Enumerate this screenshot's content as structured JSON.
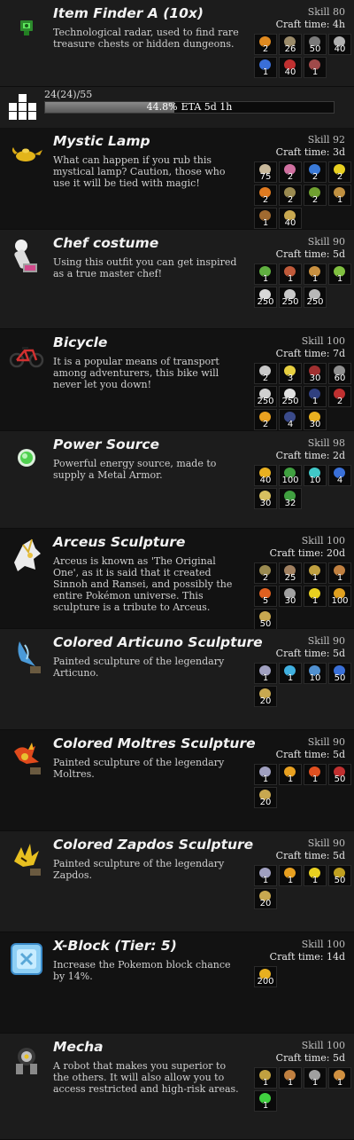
{
  "progress": {
    "count": "24(24)/55",
    "percent": "44.8%",
    "eta": "ETA 5d 1h",
    "fraction": 0.448
  },
  "items": [
    {
      "name": "Item Finder A (10x)",
      "description": "Technological radar, used to find rare treasure chests or hidden dungeons.",
      "skill": "Skill 80",
      "craft_time": "Craft time: 4h",
      "icon": "radar-icon",
      "icon_color": "#3ad13a",
      "materials": [
        {
          "icon": "orange-crystal-icon",
          "qty": "2",
          "color": "#e08a20"
        },
        {
          "icon": "gear-icon",
          "qty": "26",
          "color": "#9b8b6a"
        },
        {
          "icon": "chip-icon",
          "qty": "50",
          "color": "#7a7a7a"
        },
        {
          "icon": "wire-icon",
          "qty": "40",
          "color": "#b0b0b0"
        },
        {
          "icon": "blue-stone-icon",
          "qty": "1",
          "color": "#3a6fd8"
        },
        {
          "icon": "red-gem-icon",
          "qty": "40",
          "color": "#c03030"
        },
        {
          "icon": "wing-icon",
          "qty": "1",
          "color": "#a04a4a"
        }
      ]
    },
    {
      "name": "Mystic Lamp",
      "description": "What can happen if you rub this mystical lamp? Caution, those who use it will be tied with magic!",
      "skill": "Skill 92",
      "craft_time": "Craft time: 3d",
      "icon": "lamp-icon",
      "icon_color": "#e8c020",
      "materials": [
        {
          "icon": "scroll-icon",
          "qty": "75",
          "color": "#c8b89a"
        },
        {
          "icon": "feather-icon",
          "qty": "2",
          "color": "#d070a0"
        },
        {
          "icon": "swirl-icon",
          "qty": "2",
          "color": "#3a7ad8"
        },
        {
          "icon": "star-icon",
          "qty": "2",
          "color": "#e8d020"
        },
        {
          "icon": "flame-icon",
          "qty": "2",
          "color": "#e07a20"
        },
        {
          "icon": "rock-icon",
          "qty": "2",
          "color": "#9a8a50"
        },
        {
          "icon": "bug-icon",
          "qty": "2",
          "color": "#70a030"
        },
        {
          "icon": "figure-icon",
          "qty": "1",
          "color": "#c09040"
        },
        {
          "icon": "chest-icon",
          "qty": "1",
          "color": "#a06a30"
        },
        {
          "icon": "dust-icon",
          "qty": "40",
          "color": "#c8a850"
        }
      ]
    },
    {
      "name": "Chef costume",
      "description": "Using this outfit you can get inspired as a true master chef!",
      "skill": "Skill 90",
      "craft_time": "Craft time: 5d",
      "icon": "chef-icon",
      "icon_color": "#e8e8e8",
      "materials": [
        {
          "icon": "herb-icon",
          "qty": "1",
          "color": "#60b040"
        },
        {
          "icon": "meat-icon",
          "qty": "1",
          "color": "#c05a3a"
        },
        {
          "icon": "pie-icon",
          "qty": "1",
          "color": "#c89040"
        },
        {
          "icon": "leaf-icon",
          "qty": "1",
          "color": "#80c040"
        },
        {
          "icon": "cloth-icon",
          "qty": "250",
          "color": "#d8d8d8"
        },
        {
          "icon": "cloth-icon",
          "qty": "250",
          "color": "#c8c8c8"
        },
        {
          "icon": "cloth-icon",
          "qty": "250",
          "color": "#b8b8b8"
        }
      ]
    },
    {
      "name": "Bicycle",
      "description": "It is a popular means of transport among adventurers, this bike will never let you down!",
      "skill": "Skill 100",
      "craft_time": "Craft time: 7d",
      "icon": "bicycle-icon",
      "icon_color": "#d03030",
      "materials": [
        {
          "icon": "metal-icon",
          "qty": "2",
          "color": "#c8c8c8"
        },
        {
          "icon": "bolt-icon",
          "qty": "3",
          "color": "#e8d040"
        },
        {
          "icon": "rubber-icon",
          "qty": "30",
          "color": "#a03030"
        },
        {
          "icon": "claw-icon",
          "qty": "60",
          "color": "#909090"
        },
        {
          "icon": "plate-icon",
          "qty": "250",
          "color": "#d0d0d0"
        },
        {
          "icon": "plate-icon",
          "qty": "250",
          "color": "#e0e0e0"
        },
        {
          "icon": "nail-icon",
          "qty": "1",
          "color": "#304080"
        },
        {
          "icon": "spike-icon",
          "qty": "2",
          "color": "#c03030"
        },
        {
          "icon": "spark-icon",
          "qty": "2",
          "color": "#e8a020"
        },
        {
          "icon": "shard-icon",
          "qty": "4",
          "color": "#3a4a8a"
        },
        {
          "icon": "gold-icon",
          "qty": "30",
          "color": "#e8b020"
        }
      ]
    },
    {
      "name": "Power Source",
      "description": "Powerful energy source, made to supply a Metal Armor.",
      "skill": "Skill 98",
      "craft_time": "Craft time: 2d",
      "icon": "energy-orb-icon",
      "icon_color": "#40d040",
      "materials": [
        {
          "icon": "gold-icon",
          "qty": "40",
          "color": "#e8b020"
        },
        {
          "icon": "leaf-icon",
          "qty": "100",
          "color": "#40a040"
        },
        {
          "icon": "crystal-icon",
          "qty": "10",
          "color": "#40c8c8"
        },
        {
          "icon": "blue-gem-icon",
          "qty": "4",
          "color": "#3a70d8"
        },
        {
          "icon": "sand-icon",
          "qty": "30",
          "color": "#d8c060"
        },
        {
          "icon": "vine-icon",
          "qty": "32",
          "color": "#40a040"
        }
      ]
    },
    {
      "name": "Arceus Sculpture",
      "description": "Arceus is known as 'The Original One', as it is said that it created Sinnoh and Ransei, and possibly the entire Pokémon universe. This sculpture is a tribute to Arceus.",
      "skill": "Skill 100",
      "craft_time": "Craft time: 20d",
      "icon": "arceus-icon",
      "icon_color": "#e8e8e8",
      "materials": [
        {
          "icon": "rock-icon",
          "qty": "2",
          "color": "#9a8a50"
        },
        {
          "icon": "clay-icon",
          "qty": "25",
          "color": "#a08060"
        },
        {
          "icon": "idol-icon",
          "qty": "1",
          "color": "#c0a040"
        },
        {
          "icon": "figure-icon",
          "qty": "1",
          "color": "#c08040"
        },
        {
          "icon": "fire-icon",
          "qty": "5",
          "color": "#e06020"
        },
        {
          "icon": "claw-icon",
          "qty": "30",
          "color": "#a0a0a0"
        },
        {
          "icon": "star-icon",
          "qty": "1",
          "color": "#e8d020"
        },
        {
          "icon": "paint-icon",
          "qty": "100",
          "color": "#e0a020"
        },
        {
          "icon": "dust-icon",
          "qty": "50",
          "color": "#c8a850"
        }
      ]
    },
    {
      "name": "Colored Articuno Sculpture",
      "description": "Painted sculpture of the legendary Articuno.",
      "skill": "Skill 90",
      "craft_time": "Craft time: 5d",
      "icon": "articuno-icon",
      "icon_color": "#60a8e8",
      "materials": [
        {
          "icon": "wing-icon",
          "qty": "1",
          "color": "#a0a0c0"
        },
        {
          "icon": "ice-icon",
          "qty": "1",
          "color": "#40b0e0"
        },
        {
          "icon": "frost-icon",
          "qty": "10",
          "color": "#5090d0"
        },
        {
          "icon": "paint-icon",
          "qty": "50",
          "color": "#3a70d8"
        },
        {
          "icon": "dust-icon",
          "qty": "20",
          "color": "#c8a850"
        }
      ]
    },
    {
      "name": "Colored Moltres Sculpture",
      "description": "Painted sculpture of the legendary Moltres.",
      "skill": "Skill 90",
      "craft_time": "Craft time: 5d",
      "icon": "moltres-icon",
      "icon_color": "#e05020",
      "materials": [
        {
          "icon": "wing-icon",
          "qty": "1",
          "color": "#a0a0c0"
        },
        {
          "icon": "ember-icon",
          "qty": "1",
          "color": "#e8a020"
        },
        {
          "icon": "fire-icon",
          "qty": "1",
          "color": "#e05020"
        },
        {
          "icon": "paint-icon",
          "qty": "50",
          "color": "#c03030"
        },
        {
          "icon": "dust-icon",
          "qty": "20",
          "color": "#c8a850"
        }
      ]
    },
    {
      "name": "Colored Zapdos Sculpture",
      "description": "Painted sculpture of the legendary Zapdos.",
      "skill": "Skill 90",
      "craft_time": "Craft time: 5d",
      "icon": "zapdos-icon",
      "icon_color": "#e8c020",
      "materials": [
        {
          "icon": "wing-icon",
          "qty": "1",
          "color": "#a0a0c0"
        },
        {
          "icon": "ember-icon",
          "qty": "1",
          "color": "#e8a020"
        },
        {
          "icon": "thunder-icon",
          "qty": "1",
          "color": "#e8d020"
        },
        {
          "icon": "paint-icon",
          "qty": "50",
          "color": "#c0a020"
        },
        {
          "icon": "dust-icon",
          "qty": "20",
          "color": "#c8a850"
        }
      ]
    },
    {
      "name": "X-Block (Tier: 5)",
      "description": "Increase the Pokemon block chance by 14%.",
      "skill": "Skill 100",
      "craft_time": "Craft time: 14d",
      "icon": "x-block-icon",
      "icon_color": "#60b0e8",
      "materials": [
        {
          "icon": "gold-icon",
          "qty": "200",
          "color": "#e8b020"
        }
      ]
    },
    {
      "name": "Mecha",
      "description": "A robot that makes you superior to the others. It will also allow you to access restricted and high-risk areas.",
      "skill": "Skill 100",
      "craft_time": "Craft time: 5d",
      "icon": "mecha-icon",
      "icon_color": "#c8c8c8",
      "materials": [
        {
          "icon": "book-icon",
          "qty": "1",
          "color": "#c0a040"
        },
        {
          "icon": "figure-icon",
          "qty": "1",
          "color": "#c08040"
        },
        {
          "icon": "tool-icon",
          "qty": "1",
          "color": "#a0a0a0"
        },
        {
          "icon": "figure-icon",
          "qty": "1",
          "color": "#d09040"
        },
        {
          "icon": "green-orb-icon",
          "qty": "1",
          "color": "#40d040"
        }
      ]
    }
  ]
}
